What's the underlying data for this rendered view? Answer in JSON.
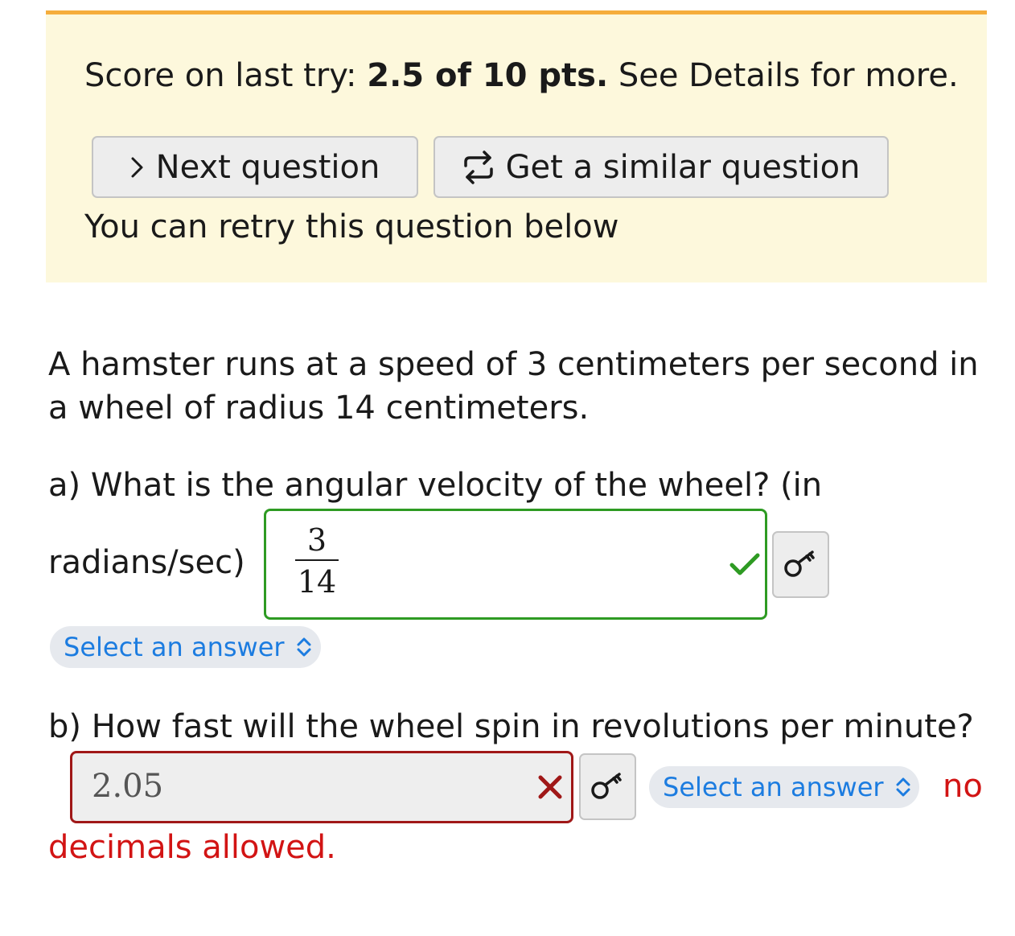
{
  "banner": {
    "score_prefix": "Score on last try: ",
    "score_value": "2.5 of 10 pts.",
    "score_suffix": " See Details for more.",
    "next_button": "Next question",
    "similar_button": "Get a similar question",
    "retry_text": "You can retry this question below",
    "accent_color": "#f5ad3c",
    "background_color": "#fdf8dc"
  },
  "question": {
    "text": "A hamster runs at a speed of 3 centimeters per second in a wheel of radius 14 centimeters.",
    "part_a": {
      "label": "a)  What is the angular velocity of the wheel? (in",
      "unit_label": "radians/sec)",
      "answer_numerator": "3",
      "answer_denominator": "14",
      "status": "correct",
      "status_icon": "check-icon",
      "select_label": "Select an answer"
    },
    "part_b": {
      "label": "b)  How fast will the wheel spin in revolutions per minute?",
      "answer_value": "2.05",
      "status": "incorrect",
      "status_icon": "cross-icon",
      "select_label": "Select an answer",
      "error_part1": "no",
      "error_part2": "decimals allowed."
    }
  },
  "colors": {
    "correct": "#2e9b23",
    "incorrect": "#a01818",
    "error_text": "#d21414",
    "link_blue": "#1c7ce0"
  }
}
